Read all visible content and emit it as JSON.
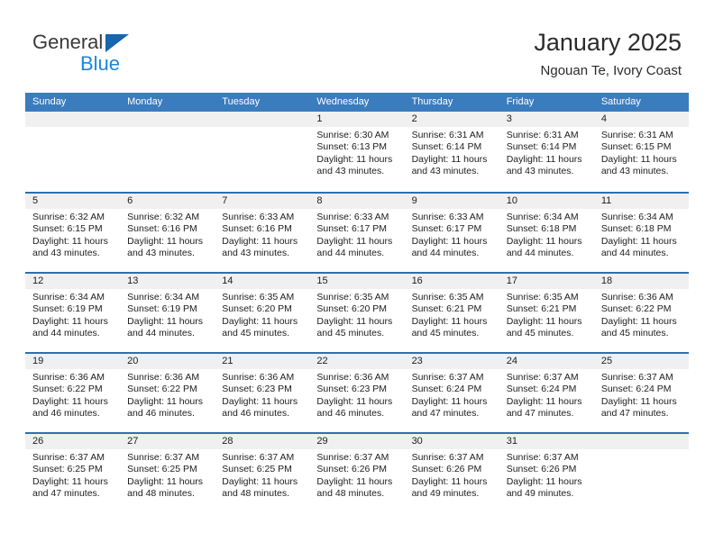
{
  "brand": {
    "name_top": "General",
    "name_bottom": "Blue",
    "triangle_color": "#1666b0",
    "blue_color": "#1b87d8"
  },
  "header": {
    "title": "January 2025",
    "subtitle": "Ngouan Te, Ivory Coast"
  },
  "colors": {
    "header_row_bg": "#3a7cbe",
    "week_separator": "#2f6fb0",
    "day_band_bg": "#f0f0f0",
    "text": "#1d1d1d"
  },
  "weekday_headers": [
    "Sunday",
    "Monday",
    "Tuesday",
    "Wednesday",
    "Thursday",
    "Friday",
    "Saturday"
  ],
  "weeks": [
    [
      {
        "day": "",
        "sunrise": "",
        "sunset": "",
        "daylight_line1": "",
        "daylight_line2": ""
      },
      {
        "day": "",
        "sunrise": "",
        "sunset": "",
        "daylight_line1": "",
        "daylight_line2": ""
      },
      {
        "day": "",
        "sunrise": "",
        "sunset": "",
        "daylight_line1": "",
        "daylight_line2": ""
      },
      {
        "day": "1",
        "sunrise": "Sunrise: 6:30 AM",
        "sunset": "Sunset: 6:13 PM",
        "daylight_line1": "Daylight: 11 hours",
        "daylight_line2": "and 43 minutes."
      },
      {
        "day": "2",
        "sunrise": "Sunrise: 6:31 AM",
        "sunset": "Sunset: 6:14 PM",
        "daylight_line1": "Daylight: 11 hours",
        "daylight_line2": "and 43 minutes."
      },
      {
        "day": "3",
        "sunrise": "Sunrise: 6:31 AM",
        "sunset": "Sunset: 6:14 PM",
        "daylight_line1": "Daylight: 11 hours",
        "daylight_line2": "and 43 minutes."
      },
      {
        "day": "4",
        "sunrise": "Sunrise: 6:31 AM",
        "sunset": "Sunset: 6:15 PM",
        "daylight_line1": "Daylight: 11 hours",
        "daylight_line2": "and 43 minutes."
      }
    ],
    [
      {
        "day": "5",
        "sunrise": "Sunrise: 6:32 AM",
        "sunset": "Sunset: 6:15 PM",
        "daylight_line1": "Daylight: 11 hours",
        "daylight_line2": "and 43 minutes."
      },
      {
        "day": "6",
        "sunrise": "Sunrise: 6:32 AM",
        "sunset": "Sunset: 6:16 PM",
        "daylight_line1": "Daylight: 11 hours",
        "daylight_line2": "and 43 minutes."
      },
      {
        "day": "7",
        "sunrise": "Sunrise: 6:33 AM",
        "sunset": "Sunset: 6:16 PM",
        "daylight_line1": "Daylight: 11 hours",
        "daylight_line2": "and 43 minutes."
      },
      {
        "day": "8",
        "sunrise": "Sunrise: 6:33 AM",
        "sunset": "Sunset: 6:17 PM",
        "daylight_line1": "Daylight: 11 hours",
        "daylight_line2": "and 44 minutes."
      },
      {
        "day": "9",
        "sunrise": "Sunrise: 6:33 AM",
        "sunset": "Sunset: 6:17 PM",
        "daylight_line1": "Daylight: 11 hours",
        "daylight_line2": "and 44 minutes."
      },
      {
        "day": "10",
        "sunrise": "Sunrise: 6:34 AM",
        "sunset": "Sunset: 6:18 PM",
        "daylight_line1": "Daylight: 11 hours",
        "daylight_line2": "and 44 minutes."
      },
      {
        "day": "11",
        "sunrise": "Sunrise: 6:34 AM",
        "sunset": "Sunset: 6:18 PM",
        "daylight_line1": "Daylight: 11 hours",
        "daylight_line2": "and 44 minutes."
      }
    ],
    [
      {
        "day": "12",
        "sunrise": "Sunrise: 6:34 AM",
        "sunset": "Sunset: 6:19 PM",
        "daylight_line1": "Daylight: 11 hours",
        "daylight_line2": "and 44 minutes."
      },
      {
        "day": "13",
        "sunrise": "Sunrise: 6:34 AM",
        "sunset": "Sunset: 6:19 PM",
        "daylight_line1": "Daylight: 11 hours",
        "daylight_line2": "and 44 minutes."
      },
      {
        "day": "14",
        "sunrise": "Sunrise: 6:35 AM",
        "sunset": "Sunset: 6:20 PM",
        "daylight_line1": "Daylight: 11 hours",
        "daylight_line2": "and 45 minutes."
      },
      {
        "day": "15",
        "sunrise": "Sunrise: 6:35 AM",
        "sunset": "Sunset: 6:20 PM",
        "daylight_line1": "Daylight: 11 hours",
        "daylight_line2": "and 45 minutes."
      },
      {
        "day": "16",
        "sunrise": "Sunrise: 6:35 AM",
        "sunset": "Sunset: 6:21 PM",
        "daylight_line1": "Daylight: 11 hours",
        "daylight_line2": "and 45 minutes."
      },
      {
        "day": "17",
        "sunrise": "Sunrise: 6:35 AM",
        "sunset": "Sunset: 6:21 PM",
        "daylight_line1": "Daylight: 11 hours",
        "daylight_line2": "and 45 minutes."
      },
      {
        "day": "18",
        "sunrise": "Sunrise: 6:36 AM",
        "sunset": "Sunset: 6:22 PM",
        "daylight_line1": "Daylight: 11 hours",
        "daylight_line2": "and 45 minutes."
      }
    ],
    [
      {
        "day": "19",
        "sunrise": "Sunrise: 6:36 AM",
        "sunset": "Sunset: 6:22 PM",
        "daylight_line1": "Daylight: 11 hours",
        "daylight_line2": "and 46 minutes."
      },
      {
        "day": "20",
        "sunrise": "Sunrise: 6:36 AM",
        "sunset": "Sunset: 6:22 PM",
        "daylight_line1": "Daylight: 11 hours",
        "daylight_line2": "and 46 minutes."
      },
      {
        "day": "21",
        "sunrise": "Sunrise: 6:36 AM",
        "sunset": "Sunset: 6:23 PM",
        "daylight_line1": "Daylight: 11 hours",
        "daylight_line2": "and 46 minutes."
      },
      {
        "day": "22",
        "sunrise": "Sunrise: 6:36 AM",
        "sunset": "Sunset: 6:23 PM",
        "daylight_line1": "Daylight: 11 hours",
        "daylight_line2": "and 46 minutes."
      },
      {
        "day": "23",
        "sunrise": "Sunrise: 6:37 AM",
        "sunset": "Sunset: 6:24 PM",
        "daylight_line1": "Daylight: 11 hours",
        "daylight_line2": "and 47 minutes."
      },
      {
        "day": "24",
        "sunrise": "Sunrise: 6:37 AM",
        "sunset": "Sunset: 6:24 PM",
        "daylight_line1": "Daylight: 11 hours",
        "daylight_line2": "and 47 minutes."
      },
      {
        "day": "25",
        "sunrise": "Sunrise: 6:37 AM",
        "sunset": "Sunset: 6:24 PM",
        "daylight_line1": "Daylight: 11 hours",
        "daylight_line2": "and 47 minutes."
      }
    ],
    [
      {
        "day": "26",
        "sunrise": "Sunrise: 6:37 AM",
        "sunset": "Sunset: 6:25 PM",
        "daylight_line1": "Daylight: 11 hours",
        "daylight_line2": "and 47 minutes."
      },
      {
        "day": "27",
        "sunrise": "Sunrise: 6:37 AM",
        "sunset": "Sunset: 6:25 PM",
        "daylight_line1": "Daylight: 11 hours",
        "daylight_line2": "and 48 minutes."
      },
      {
        "day": "28",
        "sunrise": "Sunrise: 6:37 AM",
        "sunset": "Sunset: 6:25 PM",
        "daylight_line1": "Daylight: 11 hours",
        "daylight_line2": "and 48 minutes."
      },
      {
        "day": "29",
        "sunrise": "Sunrise: 6:37 AM",
        "sunset": "Sunset: 6:26 PM",
        "daylight_line1": "Daylight: 11 hours",
        "daylight_line2": "and 48 minutes."
      },
      {
        "day": "30",
        "sunrise": "Sunrise: 6:37 AM",
        "sunset": "Sunset: 6:26 PM",
        "daylight_line1": "Daylight: 11 hours",
        "daylight_line2": "and 49 minutes."
      },
      {
        "day": "31",
        "sunrise": "Sunrise: 6:37 AM",
        "sunset": "Sunset: 6:26 PM",
        "daylight_line1": "Daylight: 11 hours",
        "daylight_line2": "and 49 minutes."
      },
      {
        "day": "",
        "sunrise": "",
        "sunset": "",
        "daylight_line1": "",
        "daylight_line2": ""
      }
    ]
  ]
}
